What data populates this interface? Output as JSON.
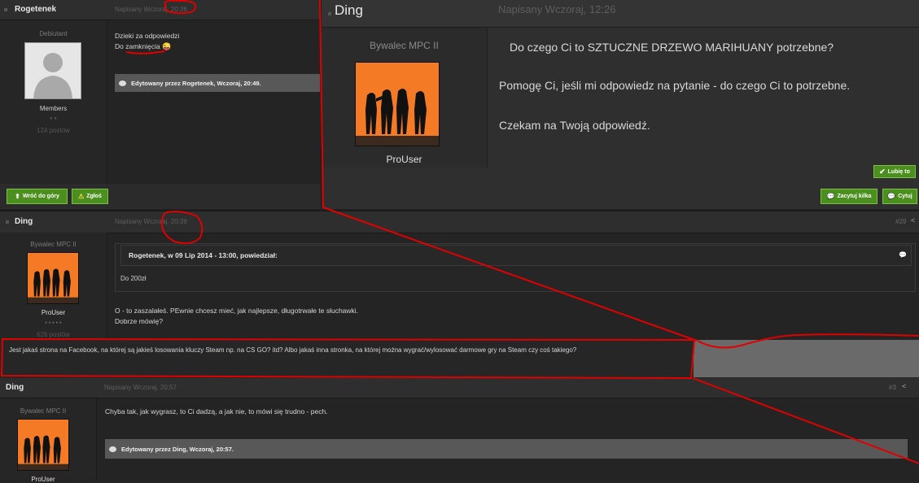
{
  "post1": {
    "username": "Rogetenek",
    "timestamp_prefix": "Napisany Wczoraj,",
    "time": "20:36",
    "rank": "Debiutant",
    "group": "Members",
    "dots": "● ●",
    "post_count": "124 postów",
    "line1": "Dzieki za odpowiedzi",
    "line2_prefix": "Do ",
    "line2_word": "zamknięcia",
    "emoji": "😜",
    "edited": "Edytowany przez Rogetenek, Wczoraj, 20:49.",
    "back_to_top": "Wróć do góry",
    "report": "Zgłoś"
  },
  "zoom": {
    "username": "Ding",
    "timestamp": "Napisany Wczoraj, 12:26",
    "rank": "Bywalec MPC II",
    "title": "ProUser",
    "line1": "Do czego Ci to SZTUCZNE DRZEWO MARIHUANY potrzebne?",
    "line2": "Pomogę Ci, jeśli mi odpowiedz na pytanie - do czego Ci to potrzebne.",
    "line3": "Czekam na Twoją odpowiedź.",
    "like": "Lubię to",
    "multi_quote": "Zacytuj kilka",
    "quote": "Cytuj"
  },
  "post2": {
    "username": "Ding",
    "timestamp": "Napisany Wczoraj, 20:39",
    "post_number": "#29",
    "rank": "Bywalec MPC II",
    "title": "ProUser",
    "dots": "● ● ● ● ●",
    "post_count": "626 postów",
    "quote_header": "Rogetenek, w 09 Lip 2014 - 13:00, powiedział:",
    "quote_body": "Do 200zł",
    "body1": "O - to zaszalałeś. PEwnie chcesz mieć, jak najlepsze, długotrwałe te słuchawki.",
    "body2": "Dobrze mówię?"
  },
  "highlight": {
    "text": "Jest jakaś strona na Facebook, na której są jakieś losowania kluczy Steam np. na CS GO? itd? Albo jakaś inna stronka, na której można wygrać/wylosować darmowe gry na Steam czy coś takiego?"
  },
  "post3": {
    "username": "Ding",
    "timestamp": "Napisany Wczoraj, 20:57",
    "post_number": "#3",
    "rank": "Bywalec MPC II",
    "title": "ProUser",
    "body": "Chyba tak, jak wygrasz, to Ci dadzą, a jak nie, to mówi się trudno - pech.",
    "edited": "Edytowany przez Ding, Wczoraj, 20:57."
  },
  "colors": {
    "background": "#242424",
    "button_green": "#4b8f1e",
    "annotation_red": "#e00000",
    "avatar_orange": "#f47a26"
  }
}
